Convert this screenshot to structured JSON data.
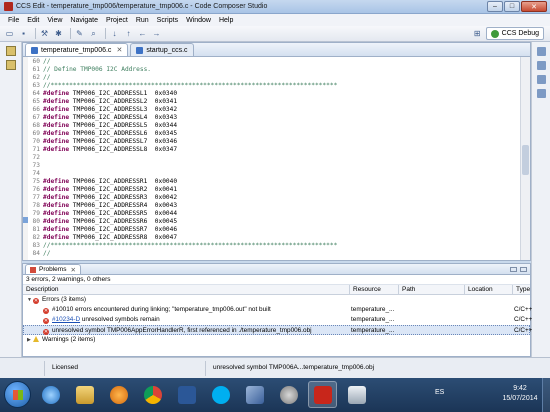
{
  "window": {
    "title": "CCS Edit - temperature_tmp006/temperature_tmp006.c - Code Composer Studio",
    "minimize": "–",
    "maximize": "□",
    "close": "✕"
  },
  "menu": [
    "File",
    "Edit",
    "View",
    "Navigate",
    "Project",
    "Run",
    "Scripts",
    "Window",
    "Help"
  ],
  "toolbar": {
    "perspective": "CCS Debug"
  },
  "editor": {
    "tabs": [
      {
        "label": "temperature_tmp006.c",
        "close": "✕"
      },
      {
        "label": "startup_ccs.c"
      }
    ],
    "lines": [
      {
        "n": "60",
        "text": "//",
        "kind": "cm"
      },
      {
        "n": "61",
        "text": "// Define TMP006 I2C Address.",
        "kind": "cm"
      },
      {
        "n": "62",
        "text": "//",
        "kind": "cm"
      },
      {
        "n": "63",
        "text": "//*****************************************************************************",
        "kind": "cm"
      },
      {
        "n": "64",
        "kw": "#define",
        "text": " TMP006_I2C_ADDRESSL1  0x0340"
      },
      {
        "n": "65",
        "kw": "#define",
        "text": " TMP006_I2C_ADDRESSL2  0x0341"
      },
      {
        "n": "66",
        "kw": "#define",
        "text": " TMP006_I2C_ADDRESSL3  0x0342"
      },
      {
        "n": "67",
        "kw": "#define",
        "text": " TMP006_I2C_ADDRESSL4  0x0343"
      },
      {
        "n": "68",
        "kw": "#define",
        "text": " TMP006_I2C_ADDRESSL5  0x0344"
      },
      {
        "n": "69",
        "kw": "#define",
        "text": " TMP006_I2C_ADDRESSL6  0x0345"
      },
      {
        "n": "70",
        "kw": "#define",
        "text": " TMP006_I2C_ADDRESSL7  0x0346"
      },
      {
        "n": "71",
        "kw": "#define",
        "text": " TMP006_I2C_ADDRESSL8  0x0347"
      },
      {
        "n": "72",
        "text": ""
      },
      {
        "n": "73",
        "text": ""
      },
      {
        "n": "74",
        "text": ""
      },
      {
        "n": "75",
        "kw": "#define",
        "text": " TMP006_I2C_ADDRESSR1  0x0040"
      },
      {
        "n": "76",
        "kw": "#define",
        "text": " TMP006_I2C_ADDRESSR2  0x0041"
      },
      {
        "n": "77",
        "kw": "#define",
        "text": " TMP006_I2C_ADDRESSR3  0x0042"
      },
      {
        "n": "78",
        "kw": "#define",
        "text": " TMP006_I2C_ADDRESSR4  0x0043"
      },
      {
        "n": "79",
        "kw": "#define",
        "text": " TMP006_I2C_ADDRESSR5  0x0044"
      },
      {
        "n": "80",
        "kw": "#define",
        "text": " TMP006_I2C_ADDRESSR6  0x0045"
      },
      {
        "n": "81",
        "kw": "#define",
        "text": " TMP006_I2C_ADDRESSR7  0x0046"
      },
      {
        "n": "82",
        "kw": "#define",
        "text": " TMP006_I2C_ADDRESSR8  0x0047"
      },
      {
        "n": "83",
        "text": "//*****************************************************************************",
        "kind": "cm"
      },
      {
        "n": "84",
        "text": "//",
        "kind": "cm"
      }
    ]
  },
  "problems": {
    "tab": "Problems",
    "tab_close": "✕",
    "summary": "3 errors, 2 warnings, 0 others",
    "columns": [
      "Description",
      "Resource",
      "Path",
      "Location",
      "Type"
    ],
    "errors_group": "Errors (3 items)",
    "error_rows": [
      {
        "prefix": "",
        "link": "",
        "desc": "#10010 errors encountered during linking; \"temperature_tmp006.out\" not built",
        "resource": "temperature_...",
        "path": "",
        "location": "",
        "type": "C/C++..."
      },
      {
        "prefix": "",
        "link": "#10234-D",
        "desc": " unresolved symbols remain",
        "resource": "temperature_...",
        "path": "",
        "location": "",
        "type": "C/C++..."
      },
      {
        "prefix": "",
        "link": "",
        "desc": "unresolved symbol TMP006AppErrorHandlerR, first referenced in ./temperature_tmp006.obj",
        "resource": "temperature_...",
        "path": "",
        "location": "",
        "type": "C/C++..."
      }
    ],
    "warnings_group": "Warnings (2 items)",
    "expand_open": "▼",
    "expand_closed": "▶"
  },
  "status": {
    "license": "Licensed",
    "message": "unresolved symbol TMP006A...temperature_tmp006.obj"
  },
  "taskbar": {
    "lang": "ES",
    "time": "9:42",
    "date": "15/07/2014"
  }
}
